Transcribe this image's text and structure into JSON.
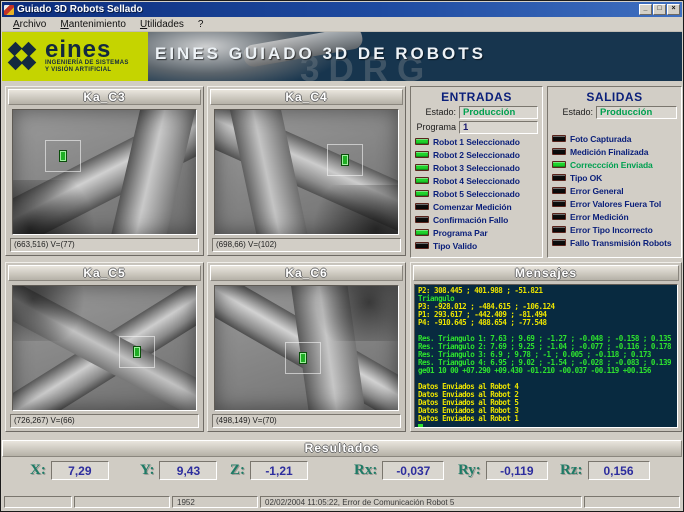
{
  "window": {
    "title": "Guiado 3D Robots Sellado",
    "buttons": {
      "minimize": "_",
      "maximize": "□",
      "close": "×"
    }
  },
  "menu": {
    "items": [
      "Archivo",
      "Mantenimiento",
      "Utilidades",
      "?"
    ]
  },
  "header": {
    "wordmark": "eines",
    "sub1": "INGENIERÍA DE SISTEMAS",
    "sub2": "Y VISIÓN ARTIFICIAL",
    "title": "EINES GUIADO 3D DE ROBOTS",
    "watermark": "3DRG",
    "logo_bg": "#c5d400",
    "header_bg": "#17354e"
  },
  "cameras": [
    {
      "name": "Ka_C3",
      "status": "(663,516) V=(77)"
    },
    {
      "name": "Ka_C4",
      "status": "(698,66) V=(102)"
    },
    {
      "name": "Ka_C5",
      "status": "(726,267) V=(66)"
    },
    {
      "name": "Ka_C6",
      "status": "(498,149) V=(70)"
    }
  ],
  "entradas": {
    "title": "ENTRADAS",
    "estado_label": "Estado:",
    "estado_value": "Producción",
    "estado_color": "#00a050",
    "programa_label": "Programa",
    "programa_value": "1",
    "programa_color": "#1a1a6e",
    "items": [
      {
        "label": "Robot 1 Seleccionado",
        "led": "#1ed32a",
        "color": "#0a1f7a"
      },
      {
        "label": "Robot 2 Seleccionado",
        "led": "#1ed32a",
        "color": "#0a1f7a"
      },
      {
        "label": "Robot 3 Seleccionado",
        "led": "#1ed32a",
        "color": "#0a1f7a"
      },
      {
        "label": "Robot 4 Seleccionado",
        "led": "#1ed32a",
        "color": "#0a1f7a"
      },
      {
        "label": "Robot 5 Seleccionado",
        "led": "#1ed32a",
        "color": "#0a1f7a"
      },
      {
        "label": "Comenzar Medición",
        "led": "#0c0c0c",
        "color": "#0a1f7a"
      },
      {
        "label": "Confirmación Fallo",
        "led": "#0c0c0c",
        "color": "#0a1f7a"
      },
      {
        "label": "Programa Par",
        "led": "#1ed32a",
        "color": "#0a1f7a"
      },
      {
        "label": "Tipo Valido",
        "led": "#0c0c0c",
        "color": "#0a1f7a"
      }
    ]
  },
  "salidas": {
    "title": "SALIDAS",
    "estado_label": "Estado:",
    "estado_value": "Producción",
    "estado_color": "#00a050",
    "items": [
      {
        "label": "Foto Capturada",
        "led": "#0c0c0c",
        "color": "#0a1f7a"
      },
      {
        "label": "Medición Finalizada",
        "led": "#0c0c0c",
        "color": "#0a1f7a"
      },
      {
        "label": "Correcccíón Enviada",
        "led": "#1ed32a",
        "color": "#00a050"
      },
      {
        "label": "Tipo OK",
        "led": "#0c0c0c",
        "color": "#0a1f7a"
      },
      {
        "label": "Error General",
        "led": "#0c0c0c",
        "color": "#0a1f7a"
      },
      {
        "label": "Error Valores Fuera Tol",
        "led": "#0c0c0c",
        "color": "#0a1f7a"
      },
      {
        "label": "Error Medición",
        "led": "#0c0c0c",
        "color": "#0a1f7a"
      },
      {
        "label": "Error Tipo Incorrecto",
        "led": "#0c0c0c",
        "color": "#0a1f7a"
      },
      {
        "label": "Fallo Transmisión Robots",
        "led": "#0c0c0c",
        "color": "#0a1f7a"
      }
    ]
  },
  "mensajes": {
    "title": "Mensajes",
    "console_bg": "#082a40",
    "lines": [
      {
        "text": "P2: 308.445 ; 401.988 ; -51.821",
        "color": "#ece400"
      },
      {
        "text": "Triangulo",
        "color": "#2ee22e"
      },
      {
        "text": "P3: -928.012 ; -484.615 ; -106.124",
        "color": "#ece400"
      },
      {
        "text": "P1: 293.617 ; -442.409 ; -81.494",
        "color": "#ece400"
      },
      {
        "text": "P4: -910.645 ; 488.654 ; -77.548",
        "color": "#ece400"
      },
      {
        "text": "",
        "color": "#ece400"
      },
      {
        "text": "Res. Triangulo 1: 7.63 ; 9.69 ; -1.27 ; -0.048 ; -0.158 ; 0.135",
        "color": "#2ee22e"
      },
      {
        "text": "Res. Triangulo 2: 7.69 ; 9.25 ; -1.04 ; -0.077 ; -0.116 ; 0.178",
        "color": "#2ee22e"
      },
      {
        "text": "Res. Triangulo 3: 6.9 ; 9.78 ; -1 ; 0.005 ; -0.118 ; 0.173",
        "color": "#2ee22e"
      },
      {
        "text": "Res. Triangulo 4: 6.95 ; 9.02 ; -1.54 ; -0.028 ; -0.083 ; 0.139",
        "color": "#2ee22e"
      },
      {
        "text": "ge01 10 00 +07.290 +09.430 -01.210 -00.037 -00.119 +00.156",
        "color": "#2ee22e"
      },
      {
        "text": "",
        "color": "#ece400"
      },
      {
        "text": "Datos Enviados al Robot 4",
        "color": "#ece400"
      },
      {
        "text": "Datos Enviados al Robot 2",
        "color": "#ece400"
      },
      {
        "text": "Datos Enviados al Robot 5",
        "color": "#ece400"
      },
      {
        "text": "Datos Enviados al Robot 3",
        "color": "#ece400"
      },
      {
        "text": "Datos Enviados al Robot 1",
        "color": "#ece400"
      }
    ]
  },
  "resultados": {
    "title": "Resultados",
    "fields": [
      {
        "label": "X:",
        "value": "7,29"
      },
      {
        "label": "Y:",
        "value": "9,43"
      },
      {
        "label": "Z:",
        "value": "-1,21"
      },
      {
        "label": "Rx:",
        "value": "-0,037"
      },
      {
        "label": "Ry:",
        "value": "-0,119"
      },
      {
        "label": "Rz:",
        "value": "0,156"
      }
    ]
  },
  "statusbar": {
    "counter": "1952",
    "message": "02/02/2004 11:05:22, Error de Comunicación Robot 5"
  }
}
